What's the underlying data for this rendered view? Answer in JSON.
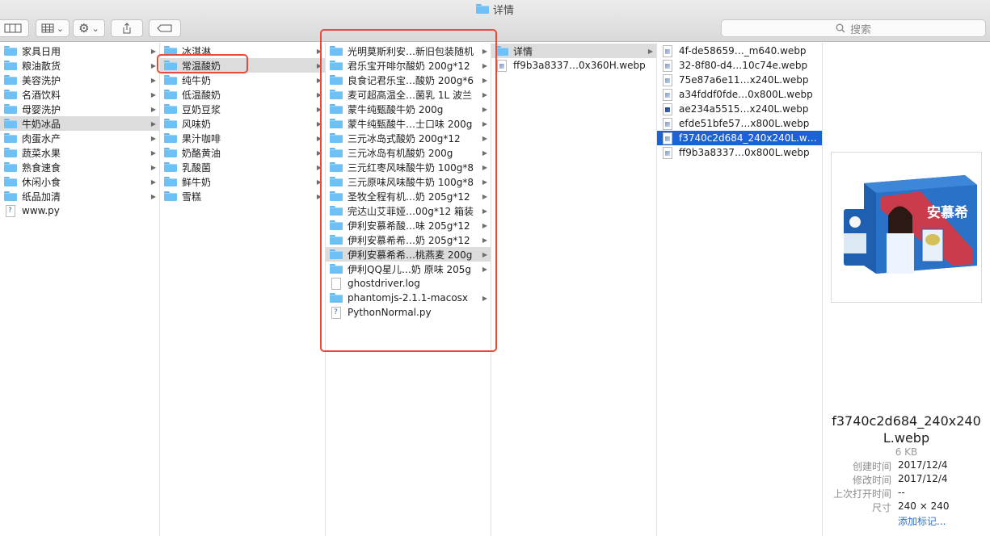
{
  "window": {
    "title": "详情",
    "search_placeholder": "搜索"
  },
  "toolbar": {
    "view_icon": "column-view-icon",
    "group_icon": "grid-icon",
    "action_icon": "gear-icon",
    "share_icon": "share-icon",
    "tag_icon": "tag-icon"
  },
  "col1": [
    {
      "label": "家具日用",
      "type": "folder"
    },
    {
      "label": "粮油散货",
      "type": "folder"
    },
    {
      "label": "美容洗护",
      "type": "folder"
    },
    {
      "label": "名酒饮料",
      "type": "folder"
    },
    {
      "label": "母婴洗护",
      "type": "folder"
    },
    {
      "label": "牛奶冰品",
      "type": "folder",
      "selected": true
    },
    {
      "label": "肉蛋水产",
      "type": "folder"
    },
    {
      "label": "蔬菜水果",
      "type": "folder"
    },
    {
      "label": "熟食速食",
      "type": "folder"
    },
    {
      "label": "休闲小食",
      "type": "folder"
    },
    {
      "label": "纸品加清",
      "type": "folder"
    },
    {
      "label": "www.py",
      "type": "py"
    }
  ],
  "col2": [
    {
      "label": "冰淇淋",
      "type": "folder"
    },
    {
      "label": "常温酸奶",
      "type": "folder",
      "selected": true
    },
    {
      "label": "纯牛奶",
      "type": "folder"
    },
    {
      "label": "低温酸奶",
      "type": "folder"
    },
    {
      "label": "豆奶豆浆",
      "type": "folder"
    },
    {
      "label": "风味奶",
      "type": "folder"
    },
    {
      "label": "果汁咖啡",
      "type": "folder"
    },
    {
      "label": "奶酪黄油",
      "type": "folder"
    },
    {
      "label": "乳酸菌",
      "type": "folder"
    },
    {
      "label": "鲜牛奶",
      "type": "folder"
    },
    {
      "label": "雪糕",
      "type": "folder"
    }
  ],
  "col3": [
    {
      "label": "光明莫斯利安…新旧包装随机",
      "type": "folder"
    },
    {
      "label": "君乐宝开啡尔酸奶 200g*12",
      "type": "folder"
    },
    {
      "label": "良食记君乐宝…酸奶 200g*6",
      "type": "folder"
    },
    {
      "label": "麦可超高温全…菌乳 1L 波兰",
      "type": "folder"
    },
    {
      "label": "蒙牛纯甄酸牛奶 200g",
      "type": "folder"
    },
    {
      "label": "蒙牛纯甄酸牛…士口味 200g",
      "type": "folder"
    },
    {
      "label": "三元冰岛式酸奶 200g*12",
      "type": "folder"
    },
    {
      "label": "三元冰岛有机酸奶 200g",
      "type": "folder"
    },
    {
      "label": "三元红枣风味酸牛奶 100g*8",
      "type": "folder"
    },
    {
      "label": "三元原味风味酸牛奶 100g*8",
      "type": "folder"
    },
    {
      "label": "圣牧全程有机…奶 205g*12",
      "type": "folder"
    },
    {
      "label": "完达山艾菲娅…00g*12 箱装",
      "type": "folder"
    },
    {
      "label": "伊利安慕希酸…味 205g*12",
      "type": "folder"
    },
    {
      "label": "伊利安慕希希…奶 205g*12",
      "type": "folder"
    },
    {
      "label": "伊利安慕希希…桃燕麦 200g",
      "type": "folder",
      "selected": true
    },
    {
      "label": "伊利QQ星儿…奶 原味 205g",
      "type": "folder"
    },
    {
      "label": "ghostdriver.log",
      "type": "doc"
    },
    {
      "label": "phantomjs-2.1.1-macosx",
      "type": "folder"
    },
    {
      "label": "PythonNormal.py",
      "type": "py"
    }
  ],
  "col4": [
    {
      "label": "详情",
      "type": "folder",
      "selected": true
    },
    {
      "label": "ff9b3a8337…0x360H.webp",
      "type": "img"
    }
  ],
  "col5": [
    {
      "label": "4f-de58659…_m640.webp",
      "type": "img"
    },
    {
      "label": "32-8f80-d4…10c74e.webp",
      "type": "img"
    },
    {
      "label": "75e87a6e11…x240L.webp",
      "type": "img"
    },
    {
      "label": "a34fddf0fde…0x800L.webp",
      "type": "img"
    },
    {
      "label": "ae234a5515…x240L.webp",
      "type": "img-dark"
    },
    {
      "label": "efde51bfe57…x800L.webp",
      "type": "img"
    },
    {
      "label": "f3740c2d684_240x240L.webp",
      "type": "img",
      "highlighted": true
    },
    {
      "label": "ff9b3a8337…0x800L.webp",
      "type": "img"
    }
  ],
  "preview": {
    "filename": "f3740c2d684_240x240L.webp",
    "size": "6 KB",
    "meta": [
      {
        "key": "创建时间",
        "value": "2017/12/4"
      },
      {
        "key": "修改时间",
        "value": "2017/12/4"
      },
      {
        "key": "上次打开时间",
        "value": "--"
      },
      {
        "key": "尺寸",
        "value": "240 × 240"
      },
      {
        "key": "",
        "value": "添加标记...",
        "link": true
      }
    ],
    "product_brand": "安慕希"
  },
  "colors": {
    "selection": "#dcdcdc",
    "highlight": "#1a63d6",
    "annotation": "#e84b3c",
    "folder": "#6ec1f7"
  }
}
